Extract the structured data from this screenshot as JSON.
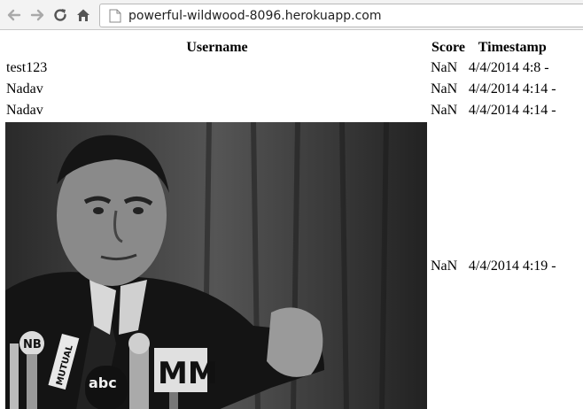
{
  "browser": {
    "url": "powerful-wildwood-8096.herokuapp.com"
  },
  "table": {
    "headers": [
      "Username",
      "Score",
      "Timestamp"
    ],
    "rows": [
      {
        "username": "test123",
        "score": "NaN",
        "timestamp": "4/4/2014 4:8 -"
      },
      {
        "username": "Nadav",
        "score": "NaN",
        "timestamp": "4/4/2014 4:14 -"
      },
      {
        "username": "Nadav",
        "score": "NaN",
        "timestamp": "4/4/2014 4:14 -"
      },
      {
        "username": "",
        "score": "NaN",
        "timestamp": "4/4/2014 4:19 -",
        "image_microphone_labels": [
          "NB",
          "MUTUAL",
          "abc",
          "MM"
        ]
      }
    ]
  }
}
